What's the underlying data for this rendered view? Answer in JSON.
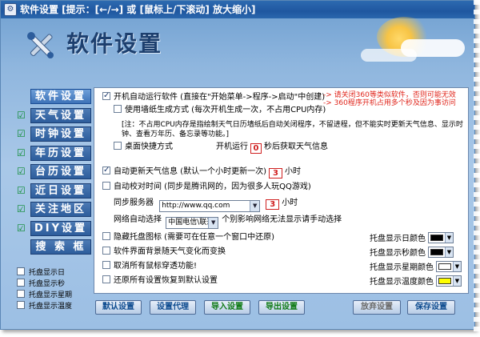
{
  "window": {
    "title": "软件设置 [提示：[←/→] 或 [鼠标上/下滚动] 放大缩小]",
    "header_title": "软件设置"
  },
  "nav": [
    {
      "label": "软件设置",
      "checked": false,
      "active": true
    },
    {
      "label": "天气设置",
      "checked": true,
      "active": false
    },
    {
      "label": "时钟设置",
      "checked": true,
      "active": false
    },
    {
      "label": "年历设置",
      "checked": true,
      "active": false
    },
    {
      "label": "台历设置",
      "checked": true,
      "active": false
    },
    {
      "label": "近日设置",
      "checked": true,
      "active": false
    },
    {
      "label": "关注地区",
      "checked": true,
      "active": false
    },
    {
      "label": "DIY设置",
      "checked": true,
      "active": false
    },
    {
      "label": "搜 索 框",
      "checked": false,
      "active": false
    }
  ],
  "tray": [
    {
      "label": "托盘显示日"
    },
    {
      "label": "托盘显示秒"
    },
    {
      "label": "托盘显示星期"
    },
    {
      "label": "托盘显示温度"
    }
  ],
  "settings": {
    "autostart_label": "开机自动运行软件  (直接在\"开始菜单->程序->启动\"中创建)",
    "autostart_warning1": "-> 请关闭360等类似软件，否则可能无效",
    "autostart_warning2": "-> 360程序开机占用多个秒及因为事访问",
    "wallpaper_label": "使用墙纸生成方式 (每次开机生成一次，不占用CPU内存)",
    "note_text": "[注：不占用CPU内存是指绘制天气日历墙纸后自动关闭程序，不留进程，但不能实时更新天气信息、显示时钟、查看万年历、备忘录等功能。]",
    "desktop_shortcut_label": "桌面快捷方式",
    "boot_run_label": "开机运行",
    "boot_seconds": "0",
    "boot_suffix": "秒后获取天气信息",
    "auto_update_label": "自动更新天气信息 (默认一个小时更新一次)",
    "auto_update_hours": "3",
    "hours_unit": "小时",
    "auto_sync_label": "自动校对时间 (同步是腾讯网的，因为很多人玩QQ游戏)",
    "sync_server_label": "同步服务器",
    "sync_server_value": "http://www.qq.com",
    "sync_hours": "3",
    "network_label": "网络自动选择",
    "network_value": "中国电信\\联通",
    "network_hint": "个别影响网络无法显示请手动选择",
    "hide_tray_label": "隐藏托盘图标 (需要可在任意一个窗口中还原)",
    "ui_bg_label": "软件界面背景随天气变化而变换",
    "disable_click_label": "取消所有鼠标穿透功能!",
    "restore_label": "还原所有设置恢复到默认设置",
    "tray_day_color_label": "托盘显示日颜色",
    "tray_sec_color_label": "托盘显示秒颜色",
    "tray_week_color_label": "托盘显示星期颜色",
    "tray_temp_color_label": "托盘显示温度颜色",
    "tray_day_color": "#000000",
    "tray_sec_color": "#000000",
    "tray_week_color": "#ffffff",
    "tray_temp_color": "#ffff00"
  },
  "buttons": {
    "default": "默认设置",
    "proxy": "设置代理",
    "import": "导入设置",
    "export": "导出设置",
    "discard": "放弃设置",
    "save": "保存设置"
  }
}
